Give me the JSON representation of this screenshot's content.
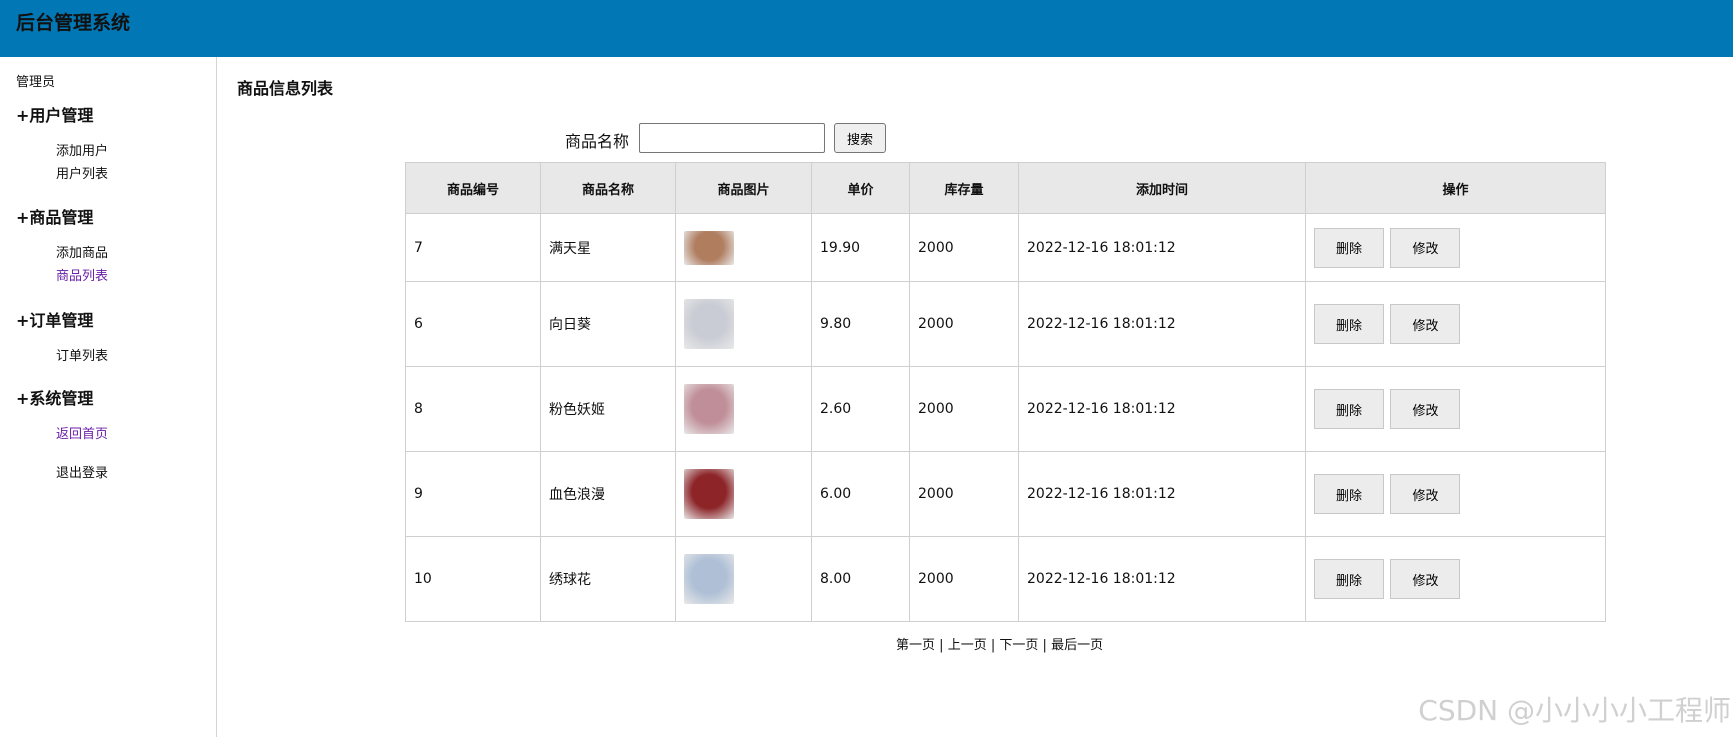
{
  "app": {
    "title": "后台管理系统"
  },
  "sidebar": {
    "user": "管理员",
    "groups": [
      {
        "label": "+用户管理",
        "items": [
          "添加用户",
          "用户列表"
        ]
      },
      {
        "label": "+商品管理",
        "items": [
          "添加商品",
          "商品列表"
        ]
      },
      {
        "label": "+订单管理",
        "items": [
          "订单列表"
        ]
      },
      {
        "label": "+系统管理",
        "items": [
          "返回首页",
          "退出登录"
        ]
      }
    ]
  },
  "main": {
    "title": "商品信息列表",
    "search": {
      "label": "商品名称",
      "value": "",
      "placeholder": "",
      "button": "搜索"
    },
    "table": {
      "headers": [
        "商品编号",
        "商品名称",
        "商品图片",
        "单价",
        "库存量",
        "添加时间",
        "操作"
      ],
      "rows": [
        {
          "id": "7",
          "name": "满天星",
          "price": "19.90",
          "stock": "2000",
          "time": "2022-12-16 18:01:12",
          "image_color": "#b07d5f"
        },
        {
          "id": "6",
          "name": "向日葵",
          "price": "9.80",
          "stock": "2000",
          "time": "2022-12-16 18:01:12",
          "image_color": "#c9ccd4"
        },
        {
          "id": "8",
          "name": "粉色妖姬",
          "price": "2.60",
          "stock": "2000",
          "time": "2022-12-16 18:01:12",
          "image_color": "#c08e98"
        },
        {
          "id": "9",
          "name": "血色浪漫",
          "price": "6.00",
          "stock": "2000",
          "time": "2022-12-16 18:01:12",
          "image_color": "#8c2428"
        },
        {
          "id": "10",
          "name": "绣球花",
          "price": "8.00",
          "stock": "2000",
          "time": "2022-12-16 18:01:12",
          "image_color": "#aebfd6"
        }
      ],
      "actions": {
        "delete": "删除",
        "edit": "修改"
      }
    },
    "pager": {
      "first": "第一页",
      "prev": "上一页",
      "next": "下一页",
      "last": "最后一页",
      "separator": "|"
    }
  },
  "watermark": "CSDN @小小小小工程师",
  "colors": {
    "header_bg": "#0277b5",
    "visited_link": "#6a1fa8",
    "table_header_bg": "#e8e8e8"
  }
}
